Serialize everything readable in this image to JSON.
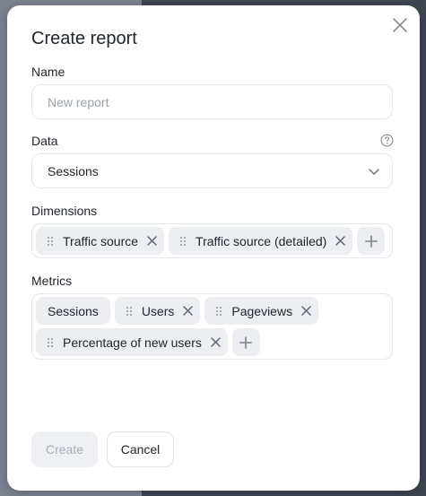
{
  "dialog": {
    "title": "Create report",
    "close_icon": "close-icon"
  },
  "name": {
    "label": "Name",
    "placeholder": "New report",
    "value": ""
  },
  "data": {
    "label": "Data",
    "selected": "Sessions",
    "help_icon": "question-circle-icon"
  },
  "dimensions": {
    "label": "Dimensions",
    "chips": [
      {
        "label": "Traffic source"
      },
      {
        "label": "Traffic source (detailed)"
      }
    ]
  },
  "metrics": {
    "label": "Metrics",
    "chips": [
      {
        "label": "Sessions"
      },
      {
        "label": "Users"
      },
      {
        "label": "Pageviews"
      },
      {
        "label": "Percentage of new users"
      }
    ]
  },
  "buttons": {
    "create": "Create",
    "cancel": "Cancel"
  },
  "colors": {
    "backdrop": "#4e5563",
    "chip_bg": "#eceef1",
    "text": "#21262e",
    "placeholder": "#9aa1ab"
  }
}
